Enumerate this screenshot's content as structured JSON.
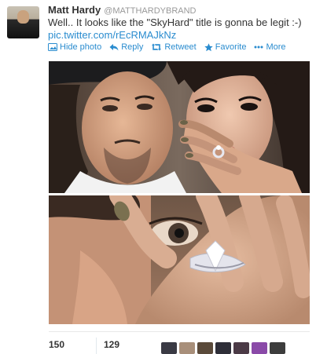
{
  "tweet": {
    "fullname": "Matt Hardy",
    "screenname": "@MATTHARDYBRAND",
    "text": "Well.. It looks like the \"SkyHard\" title is gonna be legit :-)",
    "link": "pic.twitter.com/rEcRMAJkNz"
  },
  "actions": {
    "hide_photo": "Hide photo",
    "reply": "Reply",
    "retweet": "Retweet",
    "favorite": "Favorite",
    "more": "More"
  },
  "stats": {
    "retweets": "150",
    "favorites": "129"
  },
  "colors": {
    "link": "#2a8ccf",
    "text": "#333333",
    "muted": "#999999"
  },
  "favoriters": [
    "#3a3a44",
    "#a88f7a",
    "#5a4a3a",
    "#2e2e38",
    "#4b3a46",
    "#8a4aa8",
    "#3d3d3d"
  ]
}
